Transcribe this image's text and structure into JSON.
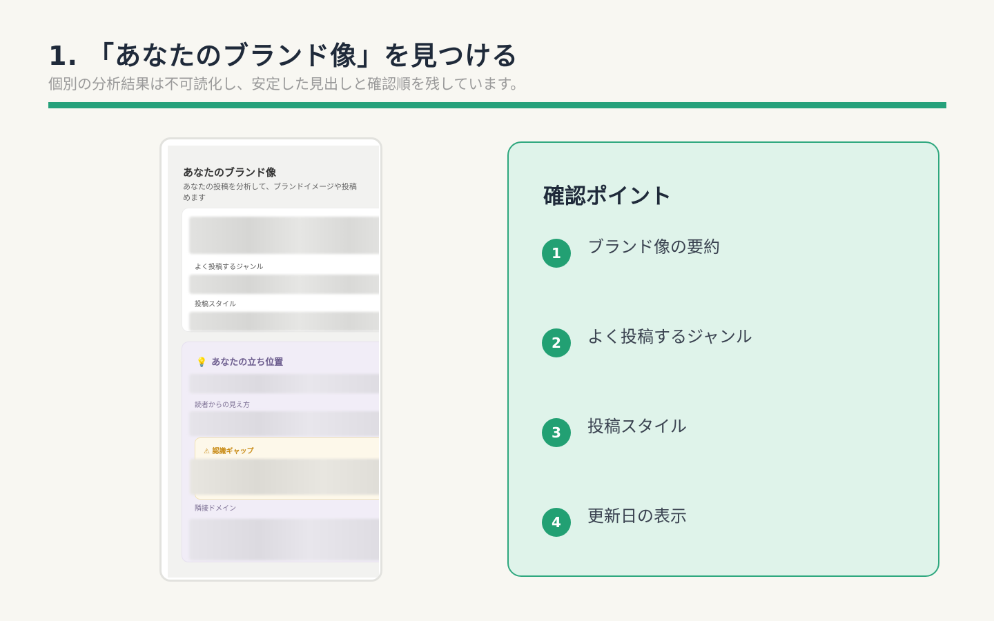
{
  "header": {
    "title": "1. 「あなたのブランド像」を見つける",
    "subtitle": "個別の分析結果は不可読化し、安定した見出しと確認順を残しています。"
  },
  "phone": {
    "title": "あなたのブランド像",
    "desc_line1": "あなたの投稿を分析して、ブランドイメージや投稿",
    "desc_line2": "めます",
    "card1": {
      "label_genre": "よく投稿するジャンル",
      "label_style": "投稿スタイル"
    },
    "card2": {
      "icon": "bulb-icon",
      "title": "あなたの立ち位置",
      "label_view": "読者からの見え方",
      "gap_title": "⚠ 認識ギャップ",
      "label_domain": "隣接ドメイン"
    }
  },
  "panel": {
    "title": "確認ポイント",
    "points": [
      {
        "num": "1",
        "label": "ブランド像の要約"
      },
      {
        "num": "2",
        "label": "よく投稿するジャンル"
      },
      {
        "num": "3",
        "label": "投稿スタイル"
      },
      {
        "num": "4",
        "label": "更新日の表示"
      }
    ]
  },
  "colors": {
    "accent": "#26a17b",
    "panel_bg": "#dff3ea",
    "page_bg": "#f8f7f2"
  }
}
